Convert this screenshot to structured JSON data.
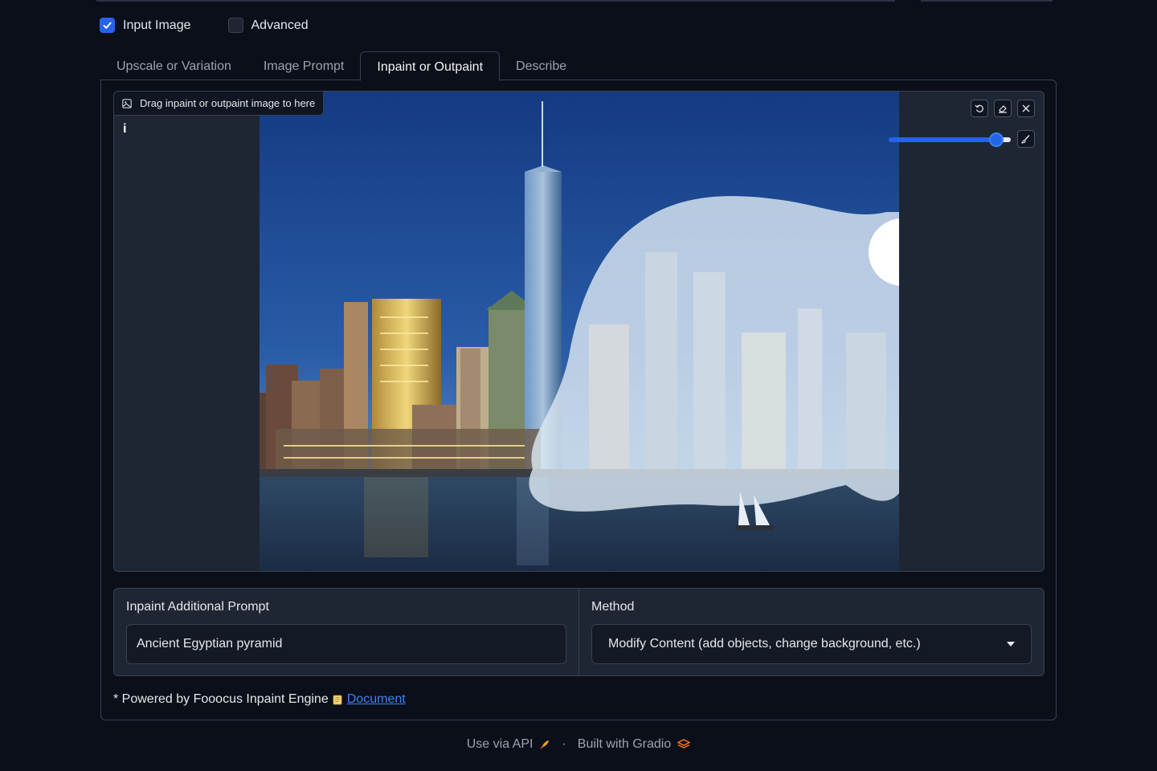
{
  "checkboxes": {
    "input_image": {
      "label": "Input Image",
      "checked": true
    },
    "advanced": {
      "label": "Advanced",
      "checked": false
    }
  },
  "tabs": [
    {
      "label": "Upscale or Variation",
      "active": false
    },
    {
      "label": "Image Prompt",
      "active": false
    },
    {
      "label": "Inpaint or Outpaint",
      "active": true
    },
    {
      "label": "Describe",
      "active": false
    }
  ],
  "editor": {
    "drag_label": "Drag inpaint or outpaint image to here",
    "info_label": "i",
    "tools": [
      "undo-icon",
      "eraser-icon",
      "close-icon",
      "brush-icon"
    ],
    "brush_size_fraction": 0.88
  },
  "inpaint_prompt": {
    "label": "Inpaint Additional Prompt",
    "value": "Ancient Egyptian pyramid"
  },
  "method": {
    "label": "Method",
    "selected": "Modify Content (add objects, change background, etc.)"
  },
  "powered_by": {
    "text": "* Powered by Fooocus Inpaint Engine",
    "link": "Document"
  },
  "footer": {
    "api_label": "Use via API",
    "separator": "·",
    "built_label": "Built with Gradio"
  },
  "colors": {
    "background": "#0b0f19",
    "panel": "#1e2634",
    "accent": "#2563eb",
    "link": "#3b82f6"
  }
}
